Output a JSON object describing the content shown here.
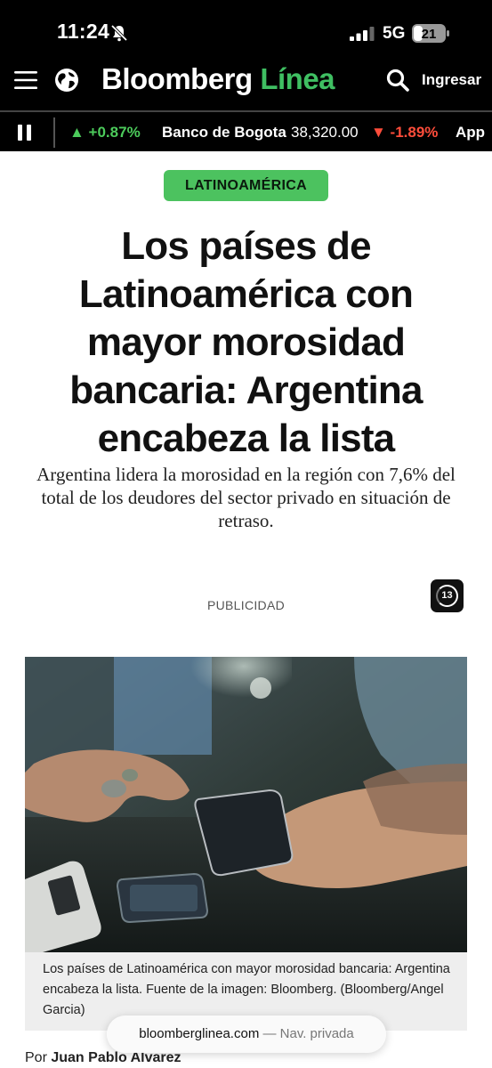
{
  "status_bar": {
    "time": "11:24",
    "network": "5G",
    "battery": "21",
    "icons": [
      "bell-slash-icon",
      "signal-icon",
      "battery-icon"
    ]
  },
  "header": {
    "brand_main": "Bloomberg",
    "brand_accent": "Línea",
    "login_label": "Ingresar",
    "icons": [
      "menu-icon",
      "globe-icon",
      "search-icon"
    ],
    "accent_color": "#3fbf62"
  },
  "ticker": {
    "items": [
      {
        "text": "▲ +0.87%",
        "direction": "up"
      },
      {
        "name": "Banco de Bogota",
        "value": "38,320.00",
        "change": "▼ -1.89%",
        "direction": "down"
      },
      {
        "name": "App"
      }
    ],
    "up_color": "#4ccb5b",
    "down_color": "#ff4d3b"
  },
  "article": {
    "category": "LATINOAMÉRICA",
    "category_color": "#4cc25f",
    "headline": "Los países de Latinoamérica con mayor morosidad bancaria: Argentina encabeza la lista",
    "subheadline": "Argentina lidera la morosidad en la región con 7,6% del total de los deudores del sector privado en situación de retraso.",
    "ad_label": "PUBLICIDAD",
    "ad_badge_count": "13",
    "image_caption": "Los países de Latinoamérica con mayor morosidad bancaria: Argentina encabeza la lista.  Fuente de la imagen: Bloomberg. (Bloomberg/Angel Garcia)",
    "byline_prefix": "Por",
    "author": "Juan Pablo Alvarez"
  },
  "browser": {
    "domain": "bloomberglinea.com",
    "mode": "— Nav. privada"
  }
}
